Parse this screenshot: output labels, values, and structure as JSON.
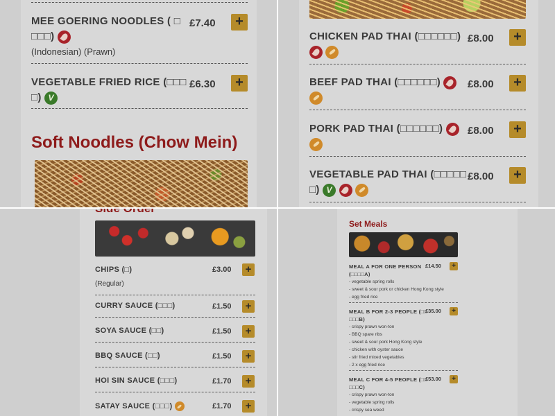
{
  "q1": {
    "items": [
      {
        "name_line1": "MEE GOERING NOODLES ( □",
        "name_line2": "□□□)",
        "sub": "(Indonesian) (Prawn)",
        "price": "£7.40",
        "add": "+"
      },
      {
        "name_line1": "VEGETABLE FRIED RICE (□□□",
        "name_line2": "□)",
        "price": "£6.30",
        "add": "+"
      }
    ],
    "section_title": "Soft Noodles (Chow Mein)"
  },
  "q2": {
    "items": [
      {
        "name": "CHICKEN PAD THAI (□□□□□□)",
        "price": "£8.00",
        "add": "+"
      },
      {
        "name": "BEEF PAD THAI (□□□□□□)",
        "price": "£8.00",
        "add": "+"
      },
      {
        "name": "PORK PAD THAI (□□□□□□)",
        "price": "£8.00",
        "add": "+"
      },
      {
        "name_line1": "VEGETABLE PAD THAI (□□□□□",
        "name_line2": "□)",
        "price": "£8.00",
        "add": "+"
      }
    ]
  },
  "q3": {
    "section_title": "Side Order",
    "items": [
      {
        "name": "CHIPS (□)",
        "sub": "(Regular)",
        "price": "£3.00",
        "add": "+"
      },
      {
        "name": "CURRY SAUCE (□□□)",
        "price": "£1.50",
        "add": "+"
      },
      {
        "name": "SOYA SAUCE (□□)",
        "price": "£1.50",
        "add": "+"
      },
      {
        "name": "BBQ SAUCE (□□)",
        "price": "£1.50",
        "add": "+"
      },
      {
        "name": "HOI SIN SAUCE (□□□)",
        "price": "£1.70",
        "add": "+"
      },
      {
        "name": "SATAY SAUCE (□□□)",
        "price": "£1.70",
        "add": "+"
      }
    ]
  },
  "q4": {
    "section_title": "Set Meals",
    "items": [
      {
        "name_line1": "MEAL A FOR ONE PERSON",
        "name_line2": "(□□□□A)",
        "price": "£14.50",
        "add": "+",
        "desc": [
          "- vegetable spring rolls",
          "- sweet & sour pork or chicken Hong Kong style",
          "- egg fried rice"
        ]
      },
      {
        "name_line1": "MEAL B FOR 2-3 PEOPLE (□□",
        "name_line2": "□□□B)",
        "price": "£35.00",
        "add": "+",
        "desc": [
          "- crispy prawn won-ton",
          "- BBQ spare ribs",
          "- sweet & sour pork Hong Kong style",
          "- chicken with oyster sauce",
          "- stir fried mixed vegetables",
          "- 2 x egg fried rice"
        ]
      },
      {
        "name_line1": "MEAL C FOR 4-5 PEOPLE (□□",
        "name_line2": "□□□C)",
        "price": "£53.00",
        "add": "+",
        "desc": [
          "- crispy prawn won-ton",
          "- vegetable spring rolls",
          "- crispy sea weed"
        ]
      }
    ]
  },
  "colors": {
    "accent_gold": "#b58b2a",
    "title_red": "#8e1b1b",
    "chili_red": "#a8232a",
    "nut_orange": "#d08a2a",
    "veg_green": "#3a7a2a"
  },
  "icons": [
    "chili-icon",
    "nut-icon",
    "vegetarian-icon",
    "plus-icon"
  ]
}
